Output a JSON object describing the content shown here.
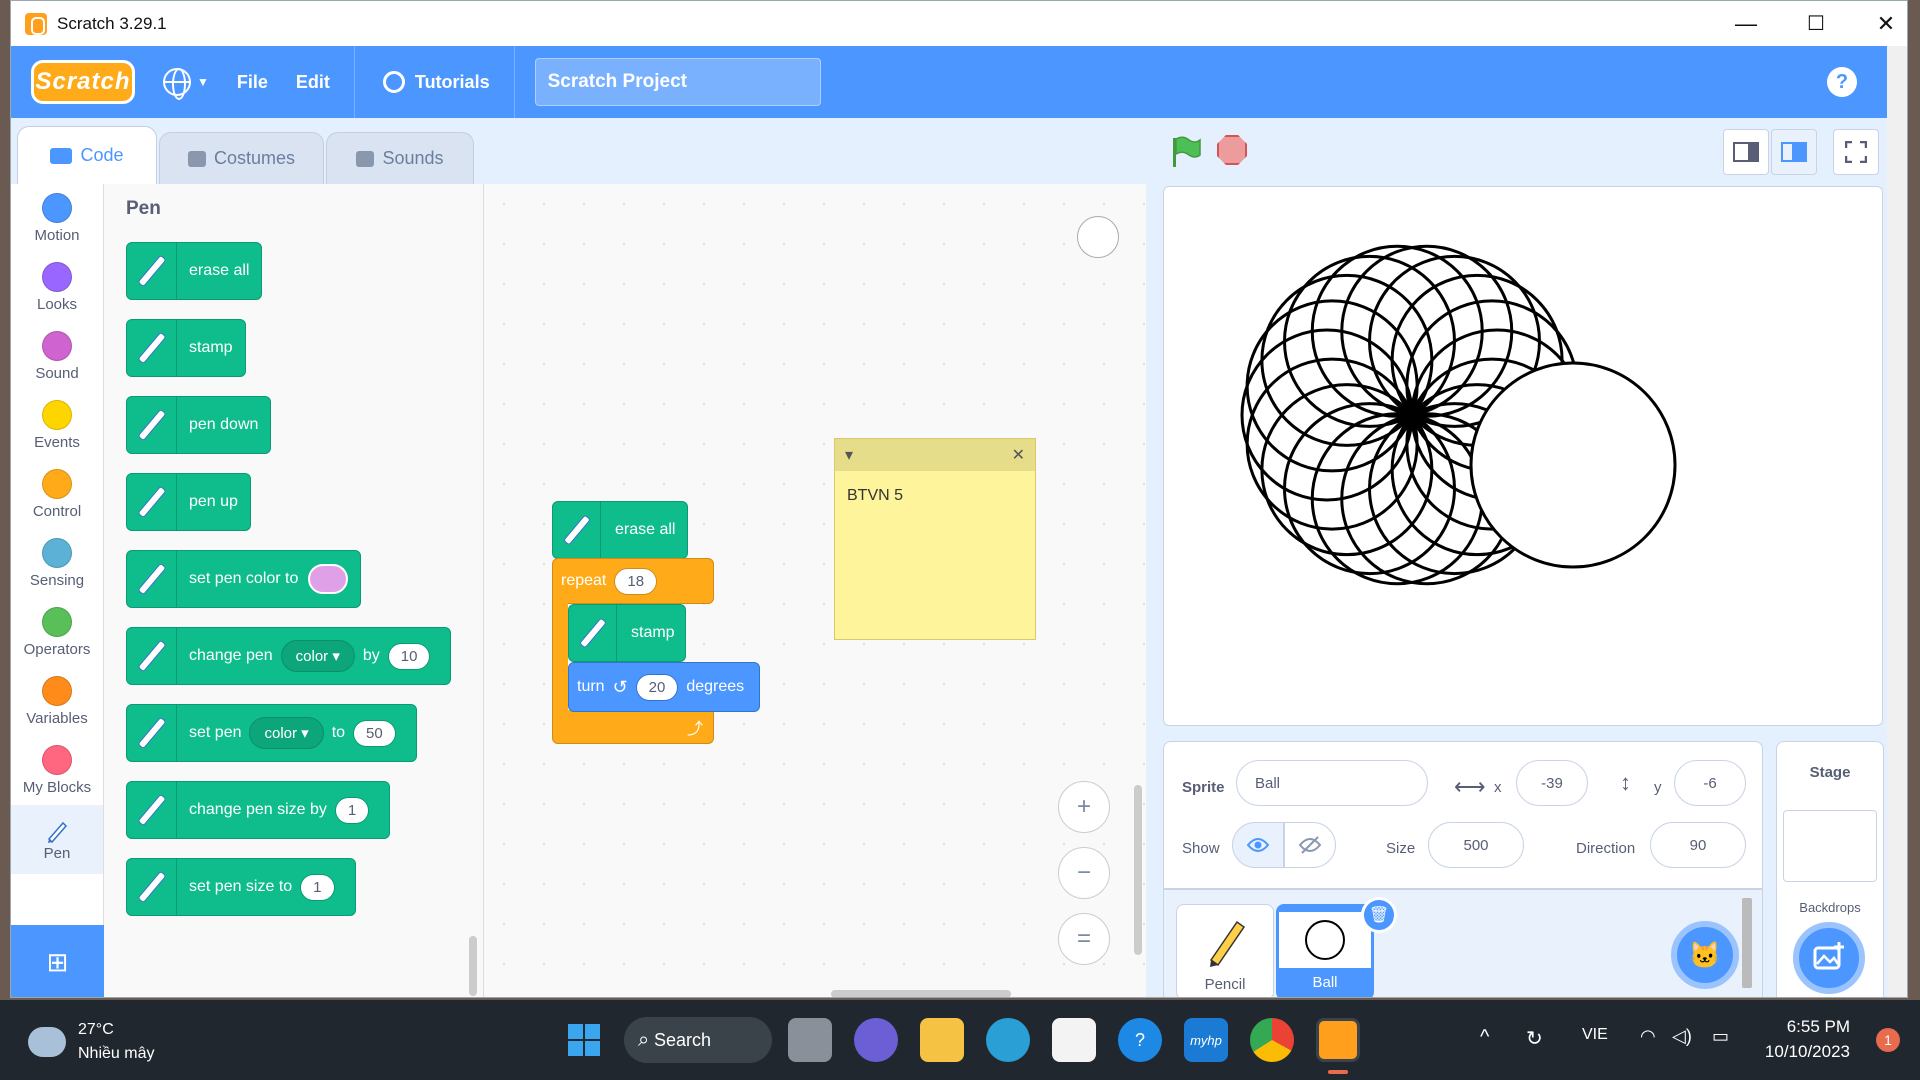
{
  "window": {
    "title": "Scratch 3.29.1",
    "minimize": "—",
    "maximize": "☐",
    "close": "✕"
  },
  "menubar": {
    "logo": "Scratch",
    "file": "File",
    "edit": "Edit",
    "tutorials": "Tutorials",
    "project_title": "Scratch Project",
    "help": "?"
  },
  "tabs": {
    "code": "Code",
    "costumes": "Costumes",
    "sounds": "Sounds"
  },
  "categories": [
    {
      "label": "Motion",
      "color": "#4c97ff"
    },
    {
      "label": "Looks",
      "color": "#9966ff"
    },
    {
      "label": "Sound",
      "color": "#cf63cf"
    },
    {
      "label": "Events",
      "color": "#ffd500"
    },
    {
      "label": "Control",
      "color": "#ffab19"
    },
    {
      "label": "Sensing",
      "color": "#5cb1d6"
    },
    {
      "label": "Operators",
      "color": "#59c059"
    },
    {
      "label": "Variables",
      "color": "#ff8c1a"
    },
    {
      "label": "My Blocks",
      "color": "#ff6680"
    },
    {
      "label": "Pen",
      "color": "#0fbd8c"
    }
  ],
  "palette": {
    "title": "Pen",
    "erase_all": "erase all",
    "stamp": "stamp",
    "pen_down": "pen down",
    "pen_up": "pen up",
    "set_pen_color": "set pen color to",
    "change_pen": "change pen",
    "color_dd": "color",
    "by": "by",
    "change_by_value": "10",
    "set_pen": "set pen",
    "to": "to",
    "set_to_value": "50",
    "change_pen_size": "change pen size by",
    "change_size_value": "1",
    "set_pen_size": "set pen size to",
    "set_size_value": "1"
  },
  "script": {
    "erase_all": "erase all",
    "repeat": "repeat",
    "repeat_count": "18",
    "stamp": "stamp",
    "turn": "turn",
    "turn_value": "20",
    "degrees": "degrees"
  },
  "note": {
    "text": "BTVN 5",
    "close": "✕"
  },
  "zoom": {
    "in": "+",
    "out": "−",
    "reset": "="
  },
  "sprite": {
    "label": "Sprite",
    "name": "Ball",
    "x_label": "x",
    "x": "-39",
    "y_label": "y",
    "y": "-6",
    "show_label": "Show",
    "size_label": "Size",
    "size": "500",
    "direction_label": "Direction",
    "direction": "90"
  },
  "sprites": [
    {
      "name": "Pencil"
    },
    {
      "name": "Ball"
    }
  ],
  "stage_pane": {
    "title": "Stage",
    "backdrops": "Backdrops"
  },
  "taskbar": {
    "temp": "27°C",
    "weather": "Nhiều mây",
    "search": "Search",
    "lang": "VIE",
    "time": "6:55 PM",
    "date": "10/10/2023",
    "notifications": "1"
  },
  "colors": {
    "accent": "#4c97ff",
    "pen": "#0fbd8c",
    "control": "#ffab19",
    "motion": "#4c97ff"
  }
}
